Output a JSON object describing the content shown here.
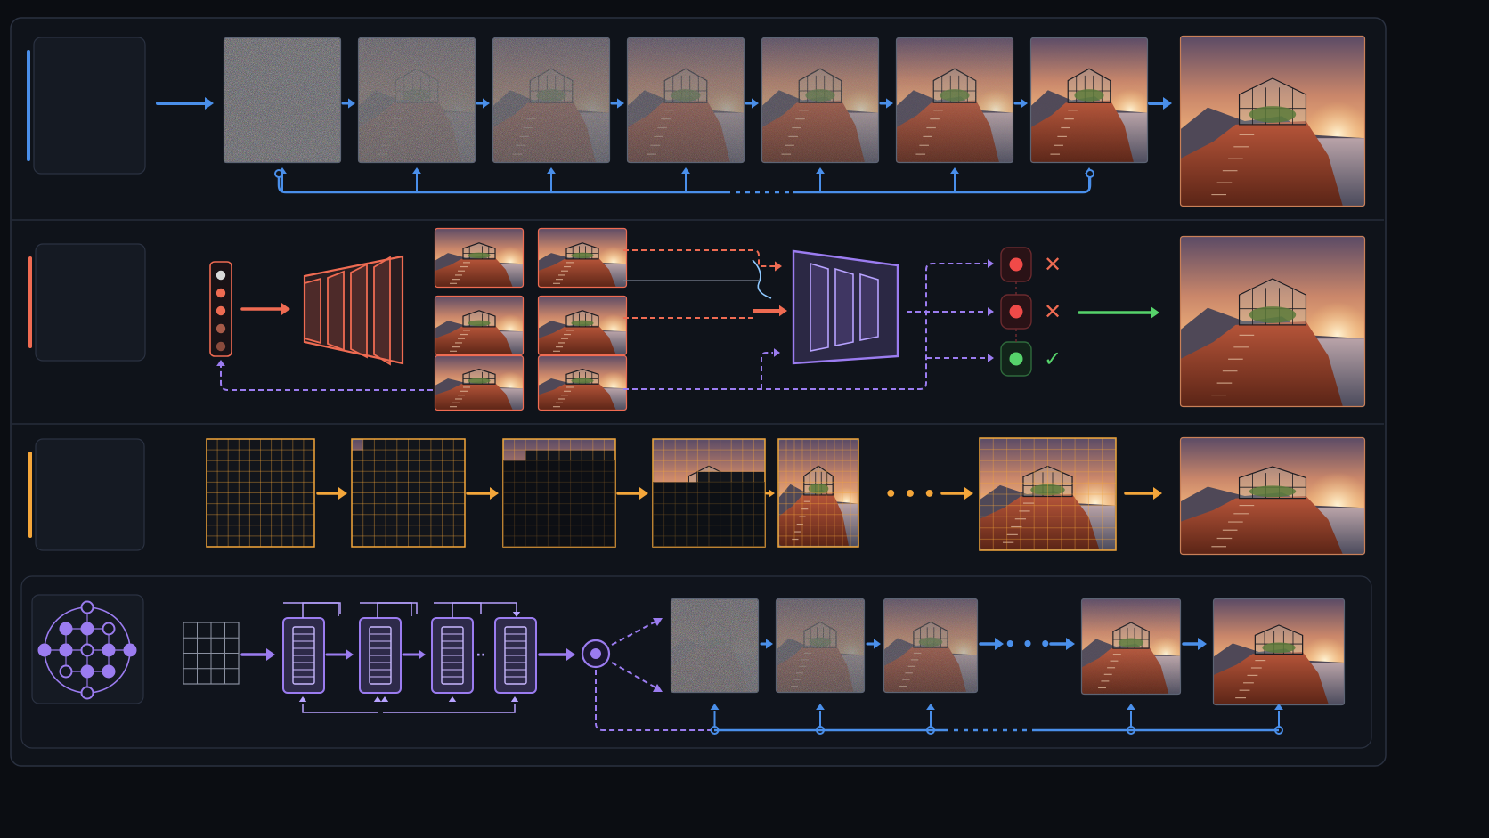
{
  "colors": {
    "background": "#0b0d12",
    "panel": "#11151d",
    "panel_border": "#2a3140",
    "blue": "#4a8fea",
    "red": "#ef6b52",
    "orange": "#f4a63a",
    "purple": "#9b7cf0",
    "green": "#56d36b",
    "red_dot": "#f04a48"
  },
  "rows": [
    {
      "id": "diffusion",
      "accent": "blue",
      "icon": "spiral-particles-icon",
      "steps": 7
    },
    {
      "id": "gan",
      "accent": "red",
      "icon": "neural-network-icon",
      "samples": 6,
      "verdicts": [
        "reject",
        "reject",
        "accept"
      ]
    },
    {
      "id": "autoregressive",
      "accent": "orange",
      "icon": "grid-icon",
      "stages": 6
    },
    {
      "id": "transformer",
      "accent": "purple",
      "icon": "token-graph-icon",
      "blocks": 4,
      "outputs": 5
    }
  ],
  "legend_symbols": {
    "reject": "✕",
    "accept": "✓",
    "ellipsis": "• • •"
  }
}
